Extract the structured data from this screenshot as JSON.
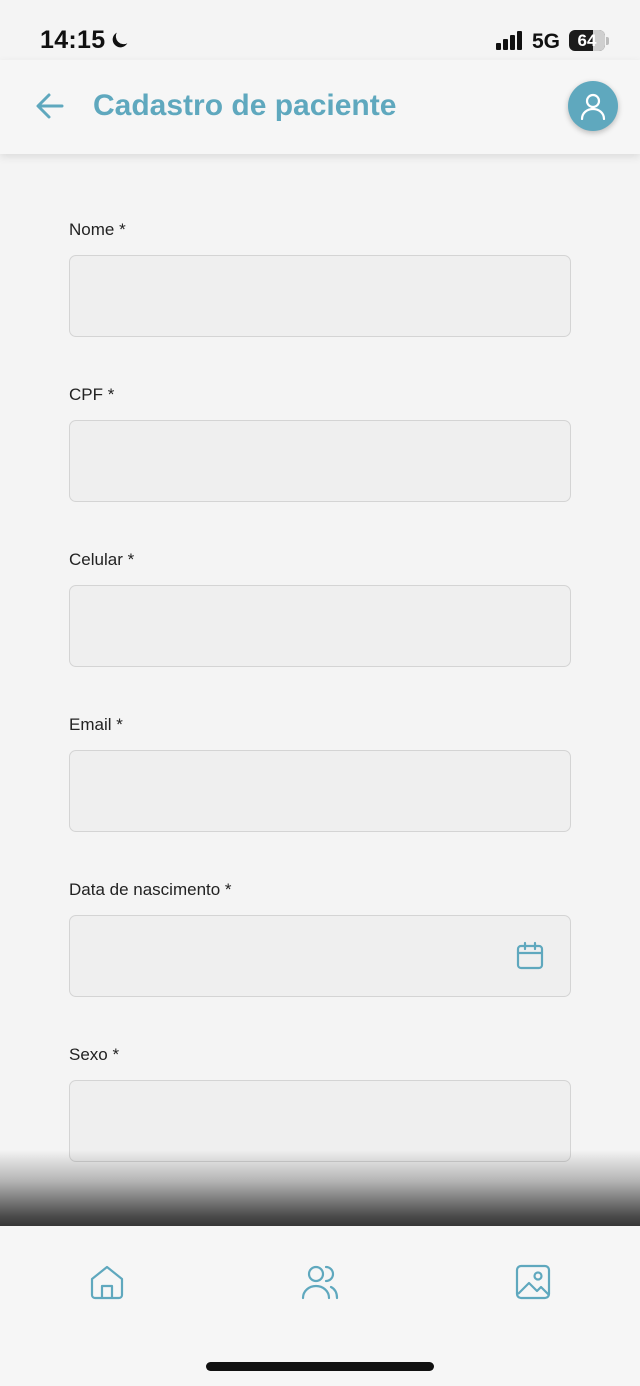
{
  "status_bar": {
    "time": "14:15",
    "network": "5G",
    "battery": "64"
  },
  "header": {
    "title": "Cadastro de paciente",
    "back_icon": "arrow-left-icon",
    "avatar_icon": "user-icon"
  },
  "form": {
    "fields": [
      {
        "label": "Nome *",
        "value": ""
      },
      {
        "label": "CPF *",
        "value": ""
      },
      {
        "label": "Celular *",
        "value": ""
      },
      {
        "label": "Email *",
        "value": ""
      },
      {
        "label": "Data de nascimento *",
        "value": "",
        "icon": "calendar-icon"
      },
      {
        "label": "Sexo *",
        "value": ""
      }
    ]
  },
  "bottom_nav": {
    "items": [
      {
        "icon": "home-icon"
      },
      {
        "icon": "users-icon"
      },
      {
        "icon": "image-icon"
      }
    ]
  },
  "colors": {
    "accent": "#5fa8be",
    "background": "#f4f4f4",
    "input_background": "#efefef"
  }
}
